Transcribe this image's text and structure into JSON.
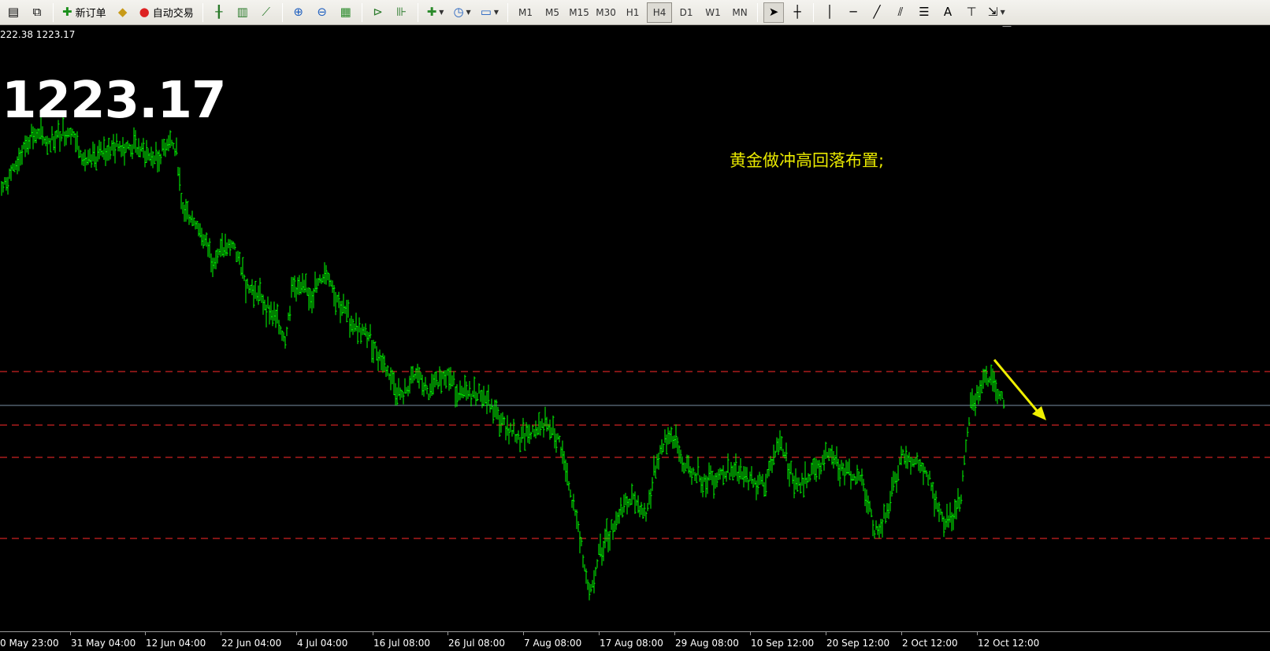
{
  "toolbar": {
    "new_order_label": "新订单",
    "auto_trading_label": "自动交易",
    "timeframes": [
      "M1",
      "M5",
      "M15",
      "M30",
      "H1",
      "H4",
      "D1",
      "W1",
      "MN"
    ],
    "active_timeframe": "H4",
    "text_tool_label": "A"
  },
  "chart": {
    "status_price": "222.38 1223.17",
    "big_price": "1223.17",
    "annotation": "黄金做冲高回落布置;",
    "time_labels": [
      "0 May 23:00",
      "31 May 04:00",
      "12 Jun 04:00",
      "22 Jun 04:00",
      "4 Jul 04:00",
      "16 Jul 08:00",
      "26 Jul 08:00",
      "7 Aug 08:00",
      "17 Aug 08:00",
      "29 Aug 08:00",
      "10 Sep 12:00",
      "20 Sep 12:00",
      "2 Oct 12:00",
      "12 Oct 12:00"
    ],
    "colors": {
      "background": "#000000",
      "candles": "#00ff00",
      "support_resistance": "#ff2a2a",
      "bid_line": "#7a8fa3",
      "arrow": "#f0f000",
      "annotation": "#e8e800"
    }
  }
}
